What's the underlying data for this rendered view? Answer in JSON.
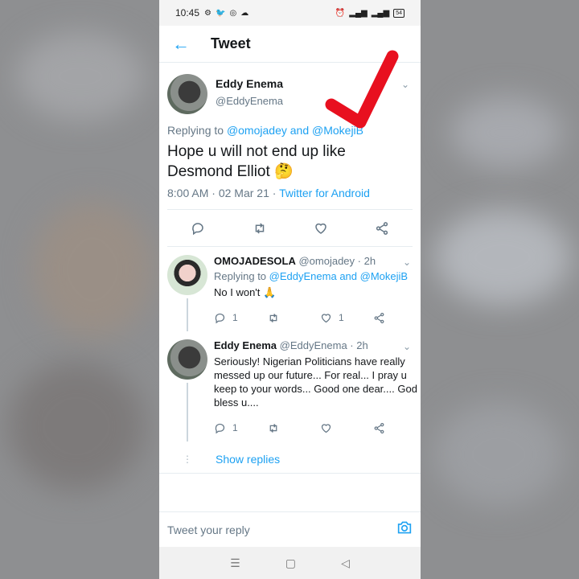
{
  "status_bar": {
    "time": "10:45",
    "battery": "54"
  },
  "header": {
    "title": "Tweet"
  },
  "main_tweet": {
    "author_name": "Eddy Enema",
    "author_handle": "@EddyEnema",
    "replying_prefix": "Replying to",
    "replying_to_1": "@omojadey",
    "replying_and": "and",
    "replying_to_2": "@MokejiB",
    "text": "Hope u will not end up like Desmond Elliot 🤔",
    "time": "8:00 AM",
    "date": "02 Mar 21",
    "source": "Twitter for Android"
  },
  "replies": [
    {
      "name": "OMOJADESOLA",
      "handle": "@omojadey",
      "age": "2h",
      "replying_prefix": "Replying to",
      "replying_to_1": "@EddyEnema",
      "replying_and": "and",
      "replying_to_2": "@MokejiB",
      "text": "No I won't 🙏",
      "reply_count": "1",
      "like_count": "1"
    },
    {
      "name": "Eddy Enema",
      "handle": "@EddyEnema",
      "age": "2h",
      "text": "Seriously! Nigerian Politicians have really messed up our future... For real... I pray u keep to your words... Good one dear.... God bless u....",
      "reply_count": "1"
    }
  ],
  "show_replies_label": "Show replies",
  "composer": {
    "placeholder": "Tweet your reply"
  },
  "colors": {
    "accent": "#1da1f2",
    "annotation": "#e8101f"
  }
}
